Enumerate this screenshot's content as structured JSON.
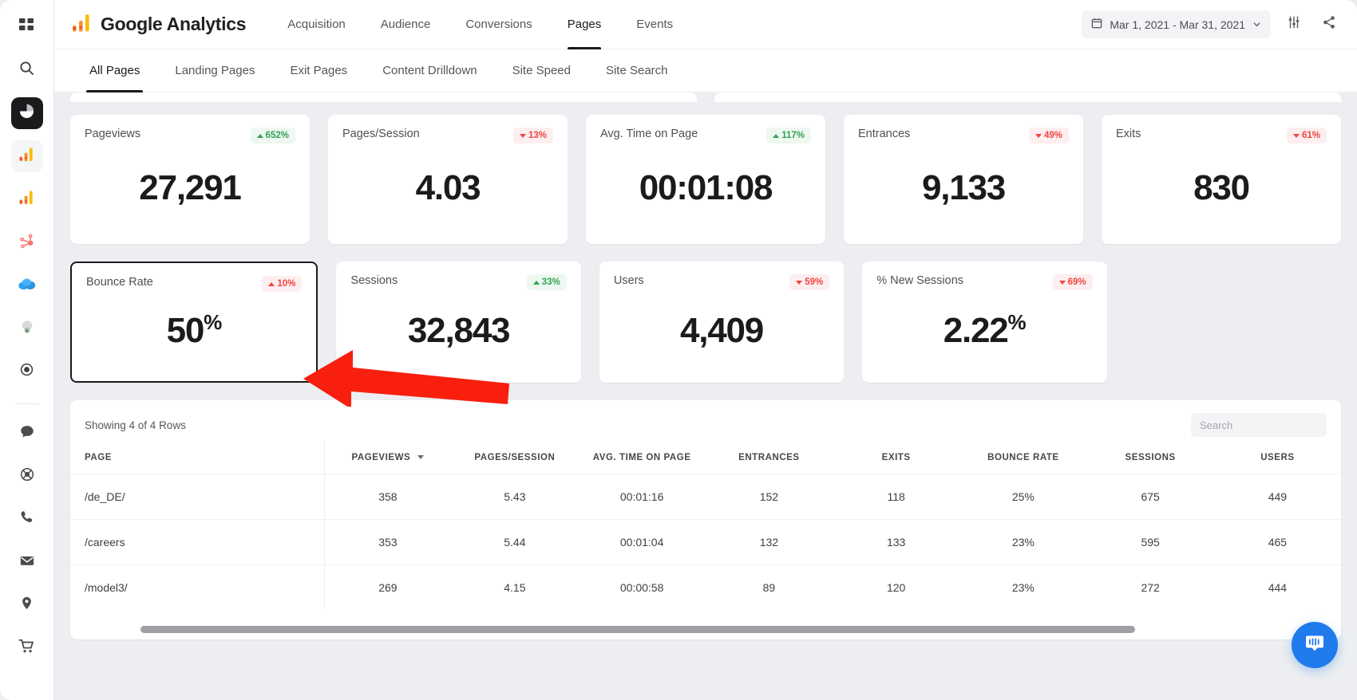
{
  "app": {
    "brand": "Google Analytics",
    "logo_icon": "google-analytics-logo-icon"
  },
  "nav": {
    "links": [
      {
        "label": "Acquisition",
        "selected": false
      },
      {
        "label": "Audience",
        "selected": false
      },
      {
        "label": "Conversions",
        "selected": false
      },
      {
        "label": "Pages",
        "selected": true
      },
      {
        "label": "Events",
        "selected": false
      }
    ],
    "date_range": "Mar 1, 2021 - Mar 31, 2021",
    "calendar_icon": "calendar-icon",
    "chevron_icon": "chevron-down-icon",
    "settings_icon": "sliders-icon",
    "share_icon": "share-icon"
  },
  "subnav": {
    "tabs": [
      {
        "label": "All Pages",
        "selected": true
      },
      {
        "label": "Landing Pages",
        "selected": false
      },
      {
        "label": "Exit Pages",
        "selected": false
      },
      {
        "label": "Content Drilldown",
        "selected": false
      },
      {
        "label": "Site Speed",
        "selected": false
      },
      {
        "label": "Site Search",
        "selected": false
      }
    ]
  },
  "sidebar": {
    "items": [
      {
        "icon": "grid-apps-icon",
        "state": "default"
      },
      {
        "icon": "search-icon",
        "state": "default"
      },
      {
        "icon": "pie-chart-icon",
        "state": "active-dark"
      },
      {
        "icon": "analytics-bar-icon",
        "state": "active-soft"
      },
      {
        "icon": "analytics-bar-alt-icon",
        "state": "default"
      },
      {
        "icon": "hubspot-icon",
        "state": "default"
      },
      {
        "icon": "salesforce-cloud-icon",
        "state": "default"
      },
      {
        "icon": "mailchimp-icon",
        "state": "default"
      },
      {
        "icon": "gear-icon",
        "state": "default"
      },
      {
        "icon": "chat-bubble-icon",
        "state": "default"
      },
      {
        "icon": "support-headset-icon",
        "state": "default"
      },
      {
        "icon": "phone-icon",
        "state": "default"
      },
      {
        "icon": "envelope-icon",
        "state": "default"
      },
      {
        "icon": "location-pin-icon",
        "state": "default"
      },
      {
        "icon": "shopping-cart-icon",
        "state": "default"
      }
    ]
  },
  "colors": {
    "positive": "#31a354",
    "negative": "#f0453f",
    "accent_dark": "#1b1b1d",
    "annotation_arrow": "#f81f0f",
    "intercom_blue": "#1f7aec"
  },
  "metrics": {
    "row1": [
      {
        "label": "Pageviews",
        "value": "27,291",
        "suffix": "",
        "delta": "652%",
        "direction": "up",
        "tone": "good"
      },
      {
        "label": "Pages/Session",
        "value": "4.03",
        "suffix": "",
        "delta": "13%",
        "direction": "down",
        "tone": "bad"
      },
      {
        "label": "Avg. Time on Page",
        "value": "00:01:08",
        "suffix": "",
        "delta": "117%",
        "direction": "up",
        "tone": "good"
      },
      {
        "label": "Entrances",
        "value": "9,133",
        "suffix": "",
        "delta": "49%",
        "direction": "down",
        "tone": "bad"
      },
      {
        "label": "Exits",
        "value": "830",
        "suffix": "",
        "delta": "61%",
        "direction": "down",
        "tone": "bad"
      }
    ],
    "row2": [
      {
        "label": "Bounce Rate",
        "value": "50",
        "suffix": "%",
        "delta": "10%",
        "direction": "up",
        "tone": "bad",
        "highlighted": true
      },
      {
        "label": "Sessions",
        "value": "32,843",
        "suffix": "",
        "delta": "33%",
        "direction": "up",
        "tone": "good",
        "highlighted": false
      },
      {
        "label": "Users",
        "value": "4,409",
        "suffix": "",
        "delta": "59%",
        "direction": "down",
        "tone": "bad",
        "highlighted": false
      },
      {
        "label": "% New Sessions",
        "value": "2.22",
        "suffix": "%",
        "delta": "69%",
        "direction": "down",
        "tone": "bad",
        "highlighted": false
      }
    ]
  },
  "table": {
    "showing": "Showing 4 of 4 Rows",
    "search_placeholder": "Search",
    "search_value": "",
    "sorted_column": "PAGEVIEWS",
    "columns": [
      "PAGE",
      "PAGEVIEWS",
      "PAGES/SESSION",
      "AVG. TIME ON PAGE",
      "ENTRANCES",
      "EXITS",
      "BOUNCE RATE",
      "SESSIONS",
      "USERS"
    ],
    "rows": [
      {
        "page": "/de_DE/",
        "pageviews": "358",
        "pages_session": "5.43",
        "avg_time": "00:01:16",
        "entrances": "152",
        "exits": "118",
        "bounce_rate": "25%",
        "sessions": "675",
        "users": "449"
      },
      {
        "page": "/careers",
        "pageviews": "353",
        "pages_session": "5.44",
        "avg_time": "00:01:04",
        "entrances": "132",
        "exits": "133",
        "bounce_rate": "23%",
        "sessions": "595",
        "users": "465"
      },
      {
        "page": "/model3/",
        "pageviews": "269",
        "pages_session": "4.15",
        "avg_time": "00:00:58",
        "entrances": "89",
        "exits": "120",
        "bounce_rate": "23%",
        "sessions": "272",
        "users": "444"
      }
    ]
  },
  "widgets": {
    "intercom_icon": "intercom-chat-icon"
  }
}
